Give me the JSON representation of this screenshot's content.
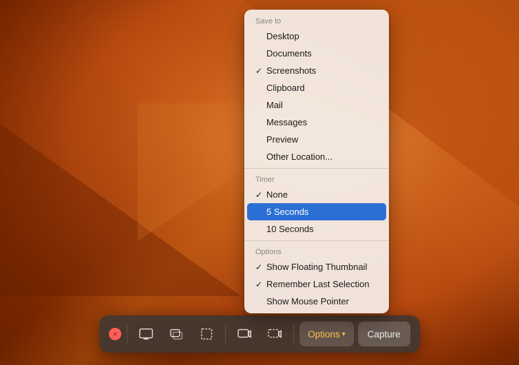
{
  "desktop": {
    "background_description": "macOS Ventura orange gradient desktop"
  },
  "menu": {
    "save_to_label": "Save to",
    "items_save": [
      {
        "id": "desktop",
        "label": "Desktop",
        "checked": false
      },
      {
        "id": "documents",
        "label": "Documents",
        "checked": false
      },
      {
        "id": "screenshots",
        "label": "Screenshots",
        "checked": true
      },
      {
        "id": "clipboard",
        "label": "Clipboard",
        "checked": false
      },
      {
        "id": "mail",
        "label": "Mail",
        "checked": false
      },
      {
        "id": "messages",
        "label": "Messages",
        "checked": false
      },
      {
        "id": "preview",
        "label": "Preview",
        "checked": false
      },
      {
        "id": "other",
        "label": "Other Location...",
        "checked": false
      }
    ],
    "timer_label": "Timer",
    "items_timer": [
      {
        "id": "none",
        "label": "None",
        "checked": true,
        "highlighted": false
      },
      {
        "id": "5sec",
        "label": "5 Seconds",
        "checked": false,
        "highlighted": true
      },
      {
        "id": "10sec",
        "label": "10 Seconds",
        "checked": false,
        "highlighted": false
      }
    ],
    "options_label": "Options",
    "items_options": [
      {
        "id": "floating-thumbnail",
        "label": "Show Floating Thumbnail",
        "checked": true
      },
      {
        "id": "remember-selection",
        "label": "Remember Last Selection",
        "checked": true
      },
      {
        "id": "mouse-pointer",
        "label": "Show Mouse Pointer",
        "checked": false
      }
    ]
  },
  "toolbar": {
    "close_label": "×",
    "buttons": [
      {
        "id": "capture-screen",
        "title": "Capture Entire Screen"
      },
      {
        "id": "capture-window",
        "title": "Capture Selected Window"
      },
      {
        "id": "capture-selection",
        "title": "Capture Selected Portion"
      },
      {
        "id": "record-screen",
        "title": "Record Entire Screen"
      },
      {
        "id": "record-selection",
        "title": "Record Selected Portion"
      }
    ],
    "options_label": "Options",
    "options_chevron": "▾",
    "capture_label": "Capture"
  }
}
